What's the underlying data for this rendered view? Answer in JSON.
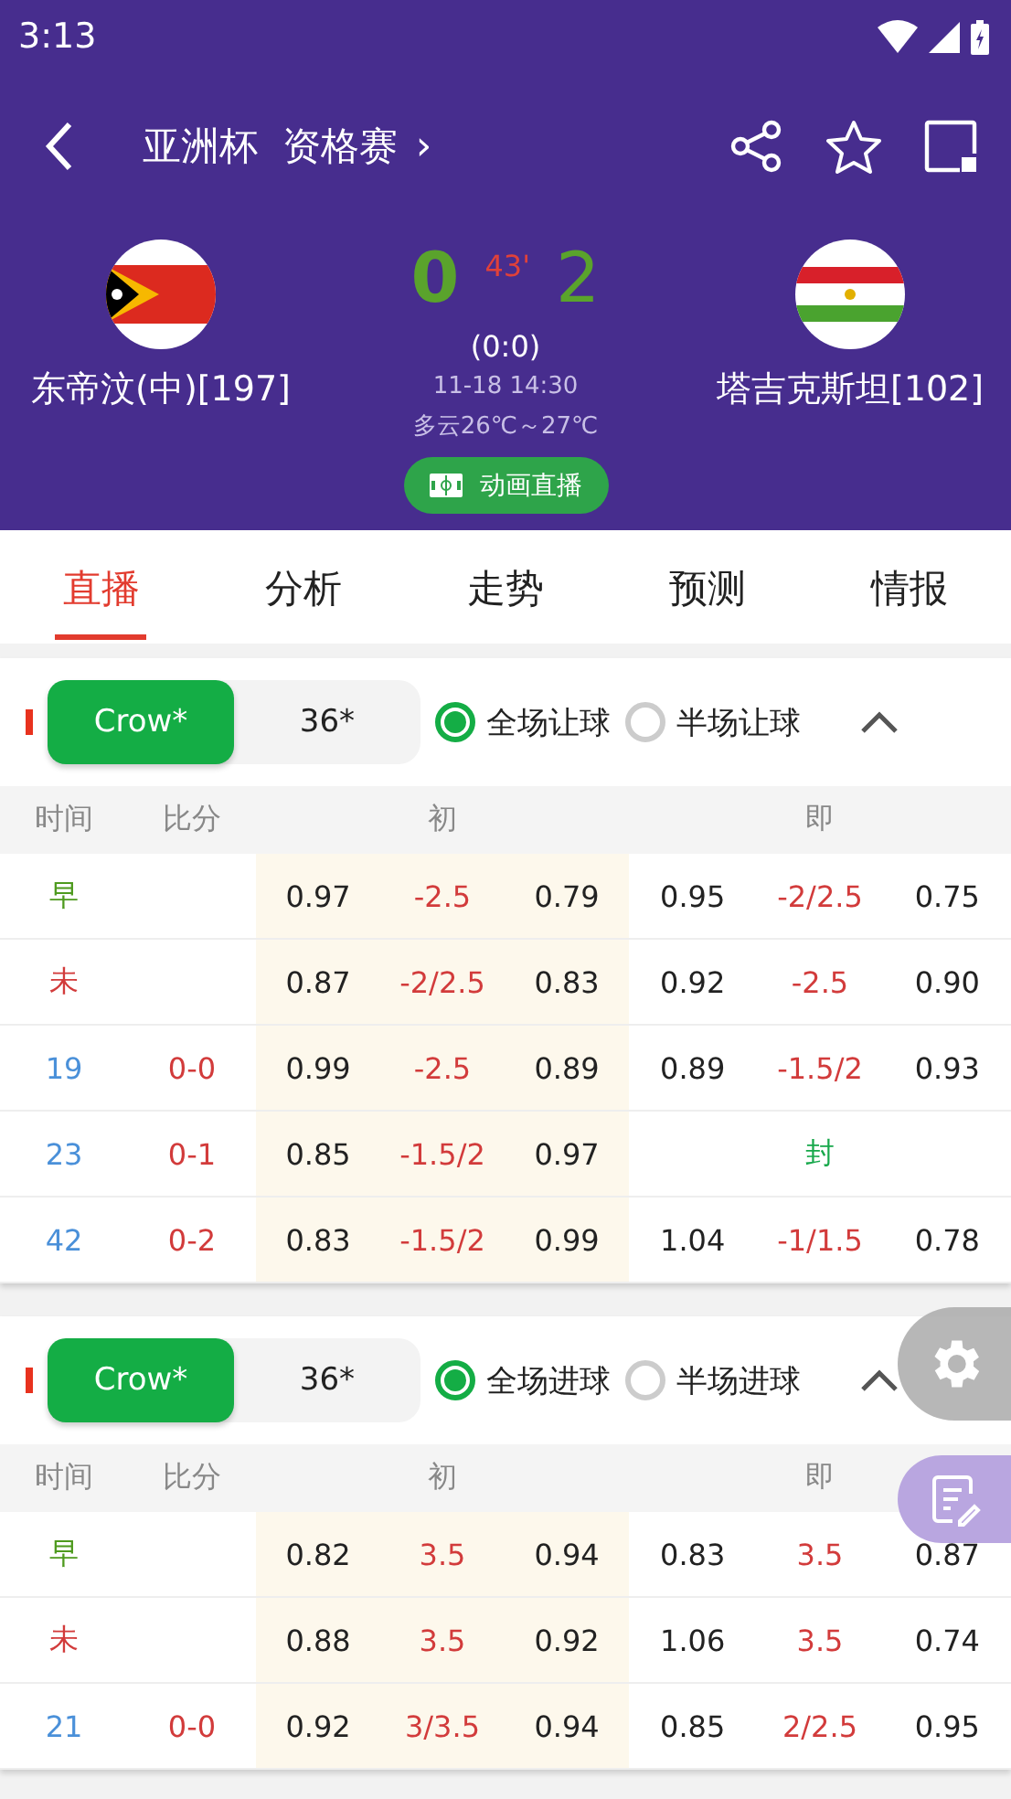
{
  "status_bar": {
    "time": "3:13"
  },
  "header": {
    "title": "亚洲杯  资格赛",
    "title_arrow": "›"
  },
  "match": {
    "home": {
      "name": "东帝汶(中)[197]"
    },
    "away": {
      "name": "塔吉克斯坦[102]"
    },
    "home_score": "0",
    "away_score": "2",
    "minute": "43'",
    "half_score": "(0:0)",
    "datetime": "11-18 14:30",
    "weather": "多云26℃～27℃",
    "live_button": "动画直播"
  },
  "tabs": [
    {
      "label": "直播",
      "selected": true
    },
    {
      "label": "分析",
      "selected": false
    },
    {
      "label": "走势",
      "selected": false
    },
    {
      "label": "预测",
      "selected": false
    },
    {
      "label": "情报",
      "selected": false
    }
  ],
  "sections": [
    {
      "companies": [
        {
          "label": "Crow*",
          "selected": true
        },
        {
          "label": "36*",
          "selected": false
        }
      ],
      "options": [
        {
          "label": "全场让球",
          "selected": true
        },
        {
          "label": "半场让球",
          "selected": false
        }
      ],
      "columns": [
        "时间",
        "比分",
        "初",
        "即"
      ],
      "rows": [
        {
          "time": "早",
          "kind": "early",
          "initial": [
            "0.97",
            "-2.5",
            "0.79"
          ],
          "live": {
            "kind": "odds",
            "values": [
              "0.95",
              "-2/2.5",
              "0.75"
            ]
          }
        },
        {
          "time": "未",
          "kind": "final",
          "initial": [
            "0.87",
            "-2/2.5",
            "0.83"
          ],
          "live": {
            "kind": "odds",
            "values": [
              "0.92",
              "-2.5",
              "0.90"
            ]
          }
        },
        {
          "time": "19",
          "kind": "minute",
          "score": "0-0",
          "initial": [
            "0.99",
            "-2.5",
            "0.89"
          ],
          "live": {
            "kind": "odds",
            "values": [
              "0.89",
              "-1.5/2",
              "0.93"
            ]
          }
        },
        {
          "time": "23",
          "kind": "minute",
          "score": "0-1",
          "initial": [
            "0.85",
            "-1.5/2",
            "0.97"
          ],
          "live": {
            "kind": "closed",
            "text": "封"
          }
        },
        {
          "time": "42",
          "kind": "minute",
          "score": "0-2",
          "initial": [
            "0.83",
            "-1.5/2",
            "0.99"
          ],
          "live": {
            "kind": "odds",
            "values": [
              "1.04",
              "-1/1.5",
              "0.78"
            ]
          }
        }
      ]
    },
    {
      "companies": [
        {
          "label": "Crow*",
          "selected": true
        },
        {
          "label": "36*",
          "selected": false
        }
      ],
      "options": [
        {
          "label": "全场进球",
          "selected": true
        },
        {
          "label": "半场进球",
          "selected": false
        }
      ],
      "columns": [
        "时间",
        "比分",
        "初",
        "即"
      ],
      "rows": [
        {
          "time": "早",
          "kind": "early",
          "initial": [
            "0.82",
            "3.5",
            "0.94"
          ],
          "live": {
            "kind": "odds",
            "values": [
              "0.83",
              "3.5",
              "0.87"
            ]
          }
        },
        {
          "time": "未",
          "kind": "final",
          "initial": [
            "0.88",
            "3.5",
            "0.92"
          ],
          "live": {
            "kind": "odds",
            "values": [
              "1.06",
              "3.5",
              "0.74"
            ]
          }
        },
        {
          "time": "21",
          "kind": "minute",
          "score": "0-0",
          "initial": [
            "0.92",
            "3/3.5",
            "0.94"
          ],
          "live": {
            "kind": "odds",
            "values": [
              "0.85",
              "2/2.5",
              "0.95"
            ]
          }
        }
      ]
    }
  ]
}
